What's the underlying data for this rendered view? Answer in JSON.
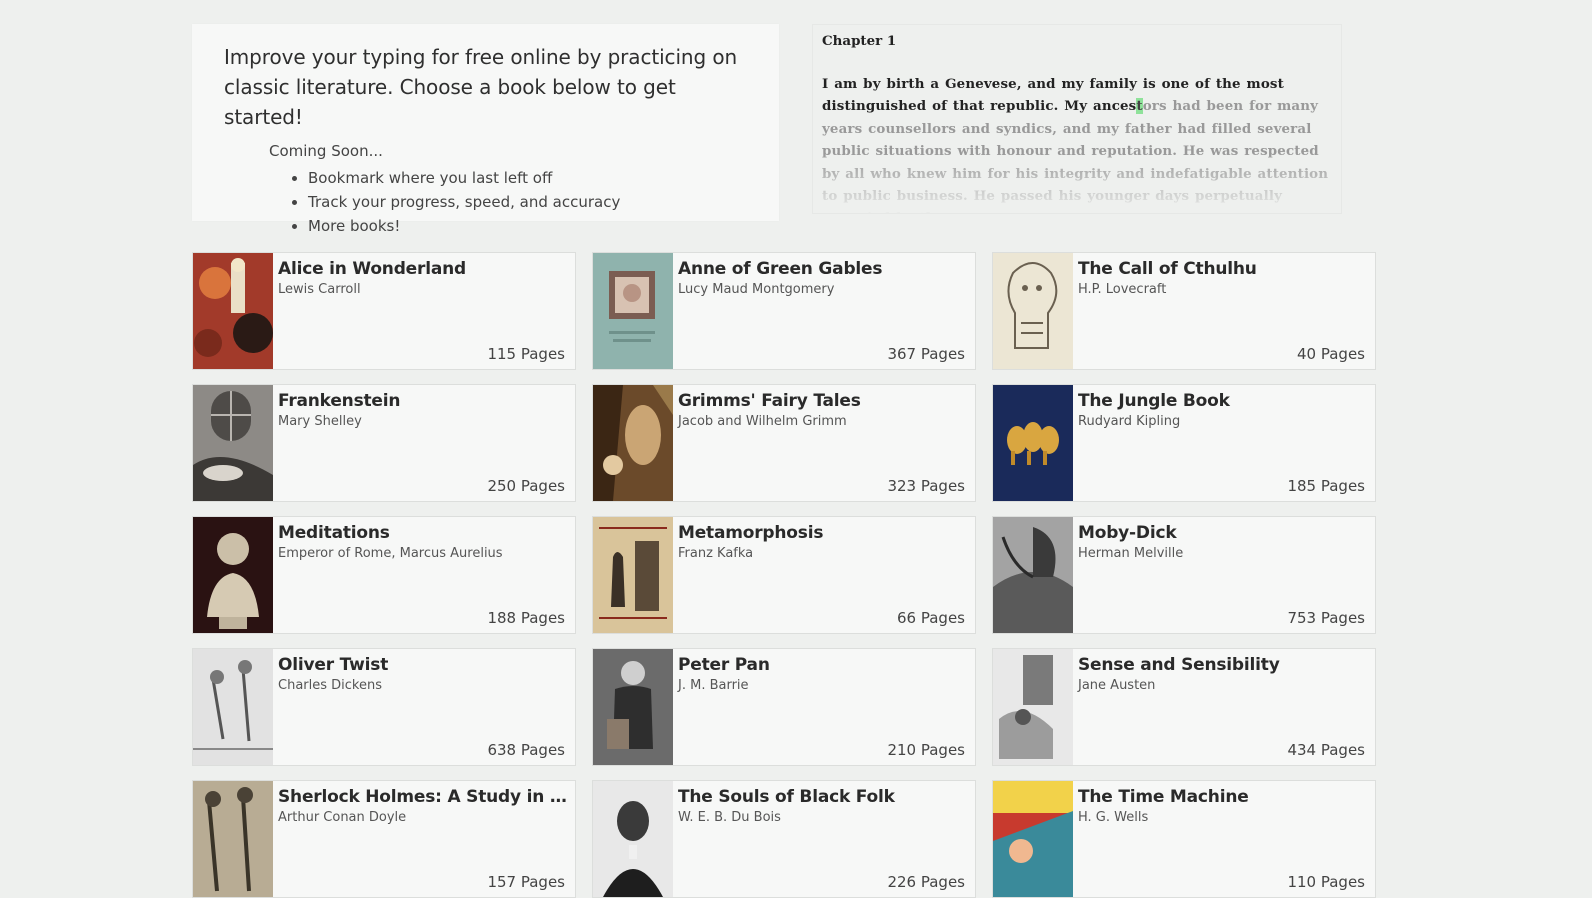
{
  "intro": {
    "title": "Improve your typing for free online by practicing on classic literature. Choose a book below to get started!",
    "coming_soon": "Coming Soon...",
    "features": [
      "Bookmark where you last left off",
      "Track your progress, speed, and accuracy",
      "More books!"
    ]
  },
  "reader": {
    "chapter": "Chapter 1",
    "typed_text": "I am by birth a Genevese, and my family is one of the most distinguished of that republic.  My ances",
    "cursor_char": "t",
    "remaining_text": "ors had been for many years counsellors and syndics, and my father had filled several public situations with honour and reputation.  He was respected by all who knew him for his integrity and indefatigable attention to public business.  He passed his younger days perpetually occupied by the"
  },
  "books": [
    {
      "title": "Alice in Wonderland",
      "author": "Lewis Carroll",
      "pages": "115 Pages",
      "cover_color": "#a23a2a"
    },
    {
      "title": "Anne of Green Gables",
      "author": "Lucy Maud Montgomery",
      "pages": "367 Pages",
      "cover_color": "#8fb3ad"
    },
    {
      "title": "The Call of Cthulhu",
      "author": "H.P. Lovecraft",
      "pages": "40 Pages",
      "cover_color": "#e8e2d0"
    },
    {
      "title": "Frankenstein",
      "author": "Mary Shelley",
      "pages": "250 Pages",
      "cover_color": "#6d6a66"
    },
    {
      "title": "Grimms' Fairy Tales",
      "author": "Jacob and Wilhelm Grimm",
      "pages": "323 Pages",
      "cover_color": "#7a5a35"
    },
    {
      "title": "The Jungle Book",
      "author": "Rudyard Kipling",
      "pages": "185 Pages",
      "cover_color": "#1a2a5a"
    },
    {
      "title": "Meditations",
      "author": "Emperor of Rome, Marcus Aurelius",
      "pages": "188 Pages",
      "cover_color": "#2a1212"
    },
    {
      "title": "Metamorphosis",
      "author": "Franz Kafka",
      "pages": "66 Pages",
      "cover_color": "#d9c49a"
    },
    {
      "title": "Moby-Dick",
      "author": "Herman Melville",
      "pages": "753 Pages",
      "cover_color": "#8a8a8a"
    },
    {
      "title": "Oliver Twist",
      "author": "Charles Dickens",
      "pages": "638 Pages",
      "cover_color": "#d8d8d8"
    },
    {
      "title": "Peter Pan",
      "author": "J. M. Barrie",
      "pages": "210 Pages",
      "cover_color": "#4a4a4a"
    },
    {
      "title": "Sense and Sensibility",
      "author": "Jane Austen",
      "pages": "434 Pages",
      "cover_color": "#cfcfcf"
    },
    {
      "title": "Sherlock Holmes: A Study in Sca...",
      "author": "Arthur Conan Doyle",
      "pages": "157 Pages",
      "cover_color": "#9a8e78"
    },
    {
      "title": "The Souls of Black Folk",
      "author": "W. E. B. Du Bois",
      "pages": "226 Pages",
      "cover_color": "#5a5a5a"
    },
    {
      "title": "The Time Machine",
      "author": "H. G. Wells",
      "pages": "110 Pages",
      "cover_color": "#c83a2e"
    }
  ]
}
